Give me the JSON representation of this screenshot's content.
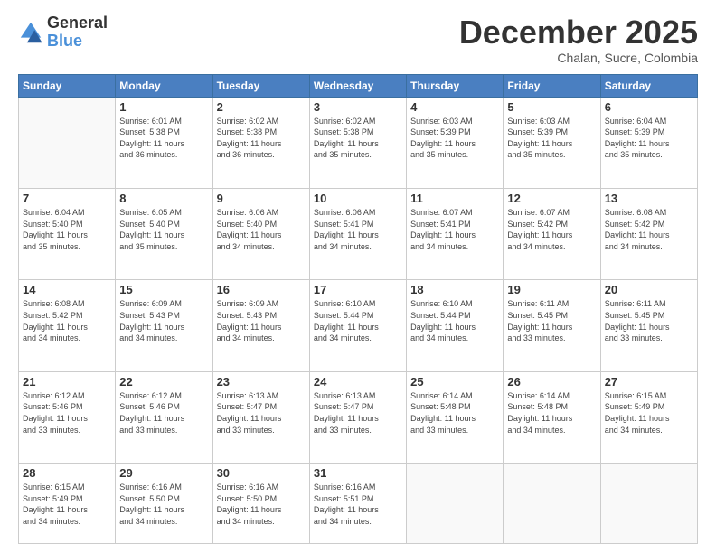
{
  "logo": {
    "general": "General",
    "blue": "Blue"
  },
  "header": {
    "month": "December 2025",
    "location": "Chalan, Sucre, Colombia"
  },
  "weekdays": [
    "Sunday",
    "Monday",
    "Tuesday",
    "Wednesday",
    "Thursday",
    "Friday",
    "Saturday"
  ],
  "weeks": [
    [
      {
        "day": "",
        "info": ""
      },
      {
        "day": "1",
        "info": "Sunrise: 6:01 AM\nSunset: 5:38 PM\nDaylight: 11 hours\nand 36 minutes."
      },
      {
        "day": "2",
        "info": "Sunrise: 6:02 AM\nSunset: 5:38 PM\nDaylight: 11 hours\nand 36 minutes."
      },
      {
        "day": "3",
        "info": "Sunrise: 6:02 AM\nSunset: 5:38 PM\nDaylight: 11 hours\nand 35 minutes."
      },
      {
        "day": "4",
        "info": "Sunrise: 6:03 AM\nSunset: 5:39 PM\nDaylight: 11 hours\nand 35 minutes."
      },
      {
        "day": "5",
        "info": "Sunrise: 6:03 AM\nSunset: 5:39 PM\nDaylight: 11 hours\nand 35 minutes."
      },
      {
        "day": "6",
        "info": "Sunrise: 6:04 AM\nSunset: 5:39 PM\nDaylight: 11 hours\nand 35 minutes."
      }
    ],
    [
      {
        "day": "7",
        "info": "Sunrise: 6:04 AM\nSunset: 5:40 PM\nDaylight: 11 hours\nand 35 minutes."
      },
      {
        "day": "8",
        "info": "Sunrise: 6:05 AM\nSunset: 5:40 PM\nDaylight: 11 hours\nand 35 minutes."
      },
      {
        "day": "9",
        "info": "Sunrise: 6:06 AM\nSunset: 5:40 PM\nDaylight: 11 hours\nand 34 minutes."
      },
      {
        "day": "10",
        "info": "Sunrise: 6:06 AM\nSunset: 5:41 PM\nDaylight: 11 hours\nand 34 minutes."
      },
      {
        "day": "11",
        "info": "Sunrise: 6:07 AM\nSunset: 5:41 PM\nDaylight: 11 hours\nand 34 minutes."
      },
      {
        "day": "12",
        "info": "Sunrise: 6:07 AM\nSunset: 5:42 PM\nDaylight: 11 hours\nand 34 minutes."
      },
      {
        "day": "13",
        "info": "Sunrise: 6:08 AM\nSunset: 5:42 PM\nDaylight: 11 hours\nand 34 minutes."
      }
    ],
    [
      {
        "day": "14",
        "info": "Sunrise: 6:08 AM\nSunset: 5:42 PM\nDaylight: 11 hours\nand 34 minutes."
      },
      {
        "day": "15",
        "info": "Sunrise: 6:09 AM\nSunset: 5:43 PM\nDaylight: 11 hours\nand 34 minutes."
      },
      {
        "day": "16",
        "info": "Sunrise: 6:09 AM\nSunset: 5:43 PM\nDaylight: 11 hours\nand 34 minutes."
      },
      {
        "day": "17",
        "info": "Sunrise: 6:10 AM\nSunset: 5:44 PM\nDaylight: 11 hours\nand 34 minutes."
      },
      {
        "day": "18",
        "info": "Sunrise: 6:10 AM\nSunset: 5:44 PM\nDaylight: 11 hours\nand 34 minutes."
      },
      {
        "day": "19",
        "info": "Sunrise: 6:11 AM\nSunset: 5:45 PM\nDaylight: 11 hours\nand 33 minutes."
      },
      {
        "day": "20",
        "info": "Sunrise: 6:11 AM\nSunset: 5:45 PM\nDaylight: 11 hours\nand 33 minutes."
      }
    ],
    [
      {
        "day": "21",
        "info": "Sunrise: 6:12 AM\nSunset: 5:46 PM\nDaylight: 11 hours\nand 33 minutes."
      },
      {
        "day": "22",
        "info": "Sunrise: 6:12 AM\nSunset: 5:46 PM\nDaylight: 11 hours\nand 33 minutes."
      },
      {
        "day": "23",
        "info": "Sunrise: 6:13 AM\nSunset: 5:47 PM\nDaylight: 11 hours\nand 33 minutes."
      },
      {
        "day": "24",
        "info": "Sunrise: 6:13 AM\nSunset: 5:47 PM\nDaylight: 11 hours\nand 33 minutes."
      },
      {
        "day": "25",
        "info": "Sunrise: 6:14 AM\nSunset: 5:48 PM\nDaylight: 11 hours\nand 33 minutes."
      },
      {
        "day": "26",
        "info": "Sunrise: 6:14 AM\nSunset: 5:48 PM\nDaylight: 11 hours\nand 34 minutes."
      },
      {
        "day": "27",
        "info": "Sunrise: 6:15 AM\nSunset: 5:49 PM\nDaylight: 11 hours\nand 34 minutes."
      }
    ],
    [
      {
        "day": "28",
        "info": "Sunrise: 6:15 AM\nSunset: 5:49 PM\nDaylight: 11 hours\nand 34 minutes."
      },
      {
        "day": "29",
        "info": "Sunrise: 6:16 AM\nSunset: 5:50 PM\nDaylight: 11 hours\nand 34 minutes."
      },
      {
        "day": "30",
        "info": "Sunrise: 6:16 AM\nSunset: 5:50 PM\nDaylight: 11 hours\nand 34 minutes."
      },
      {
        "day": "31",
        "info": "Sunrise: 6:16 AM\nSunset: 5:51 PM\nDaylight: 11 hours\nand 34 minutes."
      },
      {
        "day": "",
        "info": ""
      },
      {
        "day": "",
        "info": ""
      },
      {
        "day": "",
        "info": ""
      }
    ]
  ]
}
